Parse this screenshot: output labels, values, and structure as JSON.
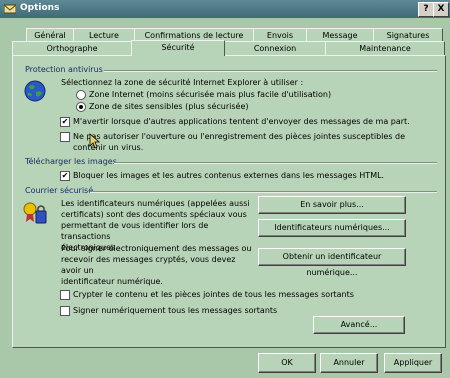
{
  "window": {
    "title": "Options",
    "help_label": "?",
    "close_label": "X"
  },
  "tabs_row1": [
    {
      "label": "Général"
    },
    {
      "label": "Lecture"
    },
    {
      "label": "Confirmations de lecture"
    },
    {
      "label": "Envois"
    },
    {
      "label": "Message"
    },
    {
      "label": "Signatures"
    }
  ],
  "tabs_row2": [
    {
      "label": "Orthographe"
    },
    {
      "label": "Sécurité"
    },
    {
      "label": "Connexion"
    },
    {
      "label": "Maintenance"
    }
  ],
  "antivirus": {
    "section_title": "Protection antivirus",
    "zone_intro": "Sélectionnez la zone de sécurité Internet Explorer à utiliser :",
    "zone_internet": "Zone Internet (moins sécurisée mais plus facile d'utilisation)",
    "zone_restricted": "Zone de sites sensibles (plus sécurisée)",
    "warn_label": "M'avertir lorsque d'autres applications tentent d'envoyer des messages de ma part.",
    "block_line1": "Ne pas autoriser l'ouverture ou l'enregistrement des pièces jointes susceptibles de",
    "block_line2": "contenir un virus."
  },
  "images": {
    "section_title": "Télécharger les images",
    "block_images_label": "Bloquer les images et les autres contenus externes dans les messages HTML."
  },
  "secure_mail": {
    "section_title": "Courrier sécurisé",
    "ids_line1": "Les identificateurs numériques (appelées aussi",
    "ids_line2": "certificats) sont des documents spéciaux vous",
    "ids_line3": "permettant de vous identifier lors de transactions",
    "ids_line4": "électroniques.",
    "sign_line1": "Pour signer électroniquement des messages ou",
    "sign_line2": "recevoir des messages cryptés, vous devez avoir un",
    "sign_line3": "identificateur numérique.",
    "learn_more_button": "En savoir plus...",
    "digital_ids_button": "Identificateurs numériques...",
    "get_id_button": "Obtenir un identificateur numérique...",
    "encrypt_label": "Crypter le contenu et les pièces jointes de tous les messages sortants",
    "sign_all_label": "Signer numériquement tous les messages sortants",
    "advanced_button": "Avancé..."
  },
  "footer": {
    "ok": "OK",
    "cancel": "Annuler",
    "apply": "Appliquer"
  }
}
